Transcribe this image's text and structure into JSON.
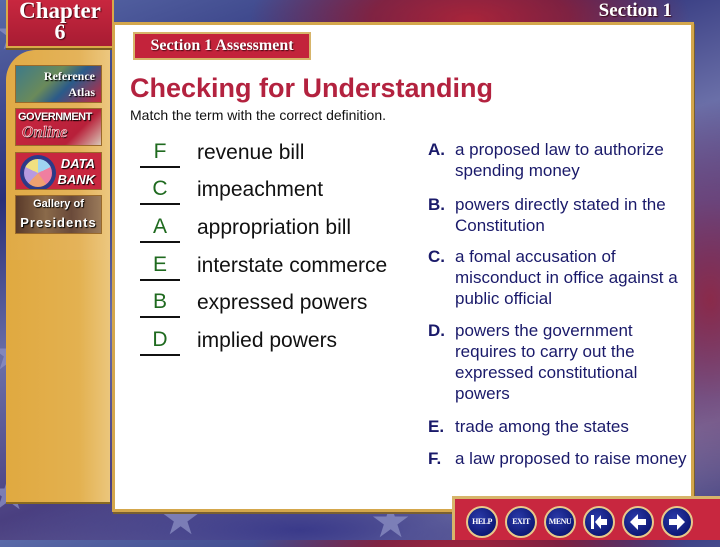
{
  "header": {
    "chapter_word": "Chapter",
    "chapter_number": "6",
    "section_label": "Section 1"
  },
  "sidebar": {
    "items": [
      {
        "line1": "Reference",
        "line2": "Atlas",
        "icon": "globe-map-icon"
      },
      {
        "line1": "GOVERNMENT",
        "line2": "Online",
        "icon": "book-icon"
      },
      {
        "line1": "DATA",
        "line2": "BANK",
        "icon": "pie-chart-icon"
      },
      {
        "line1": "Gallery of",
        "line2": "Presidents",
        "icon": "presidents-portrait-icon"
      }
    ]
  },
  "main": {
    "assessment_tab": "Section 1 Assessment",
    "title": "Checking for Understanding",
    "instruction": "Match the term with the correct definition.",
    "terms": [
      {
        "answer": "F",
        "term": "revenue bill"
      },
      {
        "answer": "C",
        "term": "impeachment"
      },
      {
        "answer": "A",
        "term": "appropriation bill"
      },
      {
        "answer": "E",
        "term": "interstate commerce"
      },
      {
        "answer": "B",
        "term": "expressed powers"
      },
      {
        "answer": "D",
        "term": "implied powers"
      }
    ],
    "definitions": [
      {
        "letter": "A.",
        "text": "a proposed law to authorize spending money"
      },
      {
        "letter": "B.",
        "text": "powers directly stated in the Constitution"
      },
      {
        "letter": "C.",
        "text": "a fomal accusation of misconduct in office against a public official"
      },
      {
        "letter": "D.",
        "text": "powers the government requires to carry out the expressed constitutional powers"
      },
      {
        "letter": "E.",
        "text": "trade among the states"
      },
      {
        "letter": "F.",
        "text": "a law proposed to raise money"
      }
    ]
  },
  "navbar": {
    "help": "HELP",
    "exit": "EXIT",
    "menu": "MENU",
    "first_icon": "first-page-icon",
    "back_icon": "back-arrow-icon",
    "next_icon": "next-arrow-icon"
  },
  "colors": {
    "title": "#b3223f",
    "answer": "#1f6a1f",
    "definition_text": "#1a1a6a",
    "brand_red": "#c8273f",
    "gold": "#d4a74c"
  }
}
